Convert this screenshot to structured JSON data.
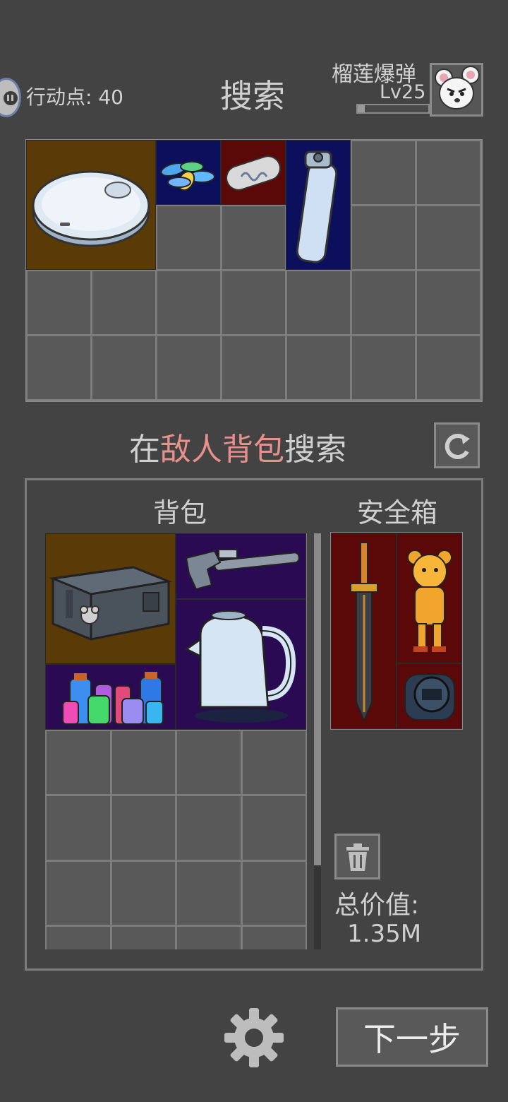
{
  "header": {
    "action_points_label": "行动点: 40",
    "title": "搜索",
    "player_name": "榴莲爆弹",
    "player_level": "Lv25",
    "xp_fraction": 0.1
  },
  "search_prompt": {
    "prefix": "在",
    "highlight": "敌人背包",
    "suffix": "搜索"
  },
  "panel": {
    "backpack_label": "背包",
    "safebox_label": "安全箱",
    "total_label": "总价值:",
    "total_value": "1.35M"
  },
  "footer": {
    "next_label": "下一步"
  },
  "loot_items": [
    {
      "name": "robot-vacuum",
      "rarity": "brown"
    },
    {
      "name": "pills",
      "rarity": "navy"
    },
    {
      "name": "capsule",
      "rarity": "maroon"
    },
    {
      "name": "water-bottle",
      "rarity": "navy"
    }
  ],
  "backpack_items": [
    {
      "name": "storage-box",
      "rarity": "brown"
    },
    {
      "name": "pipe-wrench",
      "rarity": "purple"
    },
    {
      "name": "electric-kettle",
      "rarity": "purple"
    },
    {
      "name": "potion-bottles",
      "rarity": "purple"
    }
  ],
  "safebox_items": [
    {
      "name": "sword",
      "rarity": "maroon"
    },
    {
      "name": "gold-bear-figure",
      "rarity": "maroon"
    },
    {
      "name": "watch",
      "rarity": "maroon"
    }
  ],
  "colors": {
    "background": "#434343",
    "highlight_text": "#e8918c",
    "brown_rarity": "#5a3a06",
    "navy_rarity": "#0c0f5c",
    "maroon_rarity": "#5a0808",
    "purple_rarity": "#2a0a52"
  }
}
